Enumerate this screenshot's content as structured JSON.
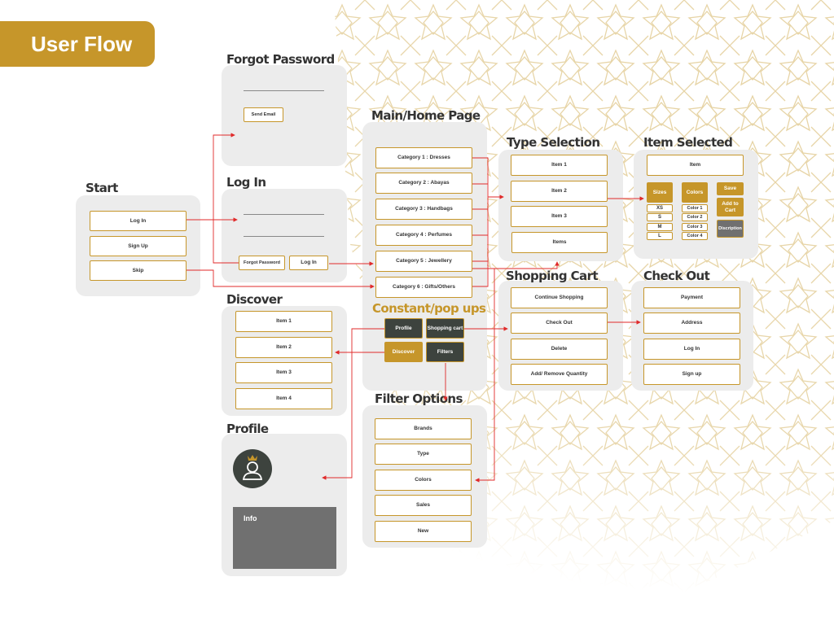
{
  "header": {
    "title": "User Flow"
  },
  "colors": {
    "accent": "#c6962a",
    "dark": "#3d433e",
    "arrow": "#e02a2a",
    "panel": "#ececec"
  },
  "sections": {
    "start": {
      "title": "Start",
      "buttons": [
        "Log In",
        "Sign Up",
        "Skip"
      ]
    },
    "forgot_password": {
      "title": "Forgot Password",
      "send_email": "Send Email"
    },
    "login": {
      "title": "Log In",
      "forgot_password": "Forgot Password",
      "login": "Log In"
    },
    "discover": {
      "title": "Discover",
      "items": [
        "Item 1",
        "Item 2",
        "Item 3",
        "Item 4"
      ]
    },
    "profile": {
      "title": "Profile",
      "info": "Info"
    },
    "home": {
      "title": "Main/Home Page",
      "categories": [
        "Category 1 : Dresses",
        "Category 2 : Abayas",
        "Category 3 : Handbags",
        "Category 4 : Perfumes",
        "Category 5 : Jewellery",
        "Category 6 : Gifts/Others"
      ]
    },
    "constant": {
      "title": "Constant/pop ups",
      "profile": "Profile",
      "shopping_cart": "Shopping cart",
      "discover": "Discover",
      "filters": "Filters"
    },
    "filter_options": {
      "title": "Filter Options",
      "items": [
        "Brands",
        "Type",
        "Colors",
        "Sales",
        "New"
      ]
    },
    "type_selection": {
      "title": "Type Selection",
      "items": [
        "Item 1",
        "Item 2",
        "Item 3",
        "Items"
      ]
    },
    "item_selected": {
      "title": "Item Selected",
      "item": "Item",
      "sizes_label": "Sizes",
      "sizes": [
        "XS",
        "S",
        "M",
        "L"
      ],
      "colors_label": "Colors",
      "colors": [
        "Color 1",
        "Color 2",
        "Color 3",
        "Color 4"
      ],
      "save": "Save",
      "add_to_cart": "Add to Cart",
      "description": "Discription"
    },
    "shopping_cart": {
      "title": "Shopping Cart",
      "items": [
        "Continue Shopping",
        "Check Out",
        "Delete",
        "Add/ Remove Quantity"
      ]
    },
    "check_out": {
      "title": "Check Out",
      "items": [
        "Payment",
        "Address",
        "Log In",
        "Sign up"
      ]
    }
  }
}
